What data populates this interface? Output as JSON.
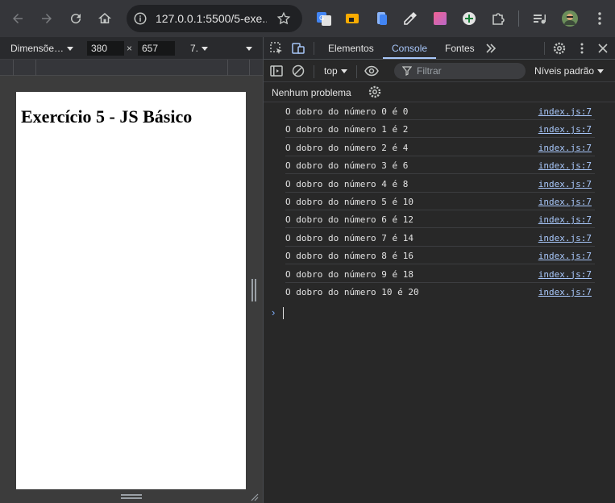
{
  "browser": {
    "url": "127.0.0.1:5500/5-exe...",
    "nav": [
      "back-icon",
      "forward-icon",
      "reload-icon",
      "home-icon"
    ],
    "extensions": [
      "google-translate-icon",
      "extension-icon",
      "extension-icon",
      "eyedropper-icon",
      "extension-icon",
      "plus-icon",
      "puzzle-icon",
      "media-icon",
      "avatar",
      "more-icon"
    ]
  },
  "device_toolbar": {
    "dimensions_label": "Dimensõe…",
    "width": "380",
    "times": "×",
    "height": "657",
    "zoom": "7."
  },
  "page": {
    "heading": "Exercício 5 - JS Básico"
  },
  "devtools": {
    "tabs": [
      {
        "label": "Elementos",
        "active": false
      },
      {
        "label": "Console",
        "active": true
      },
      {
        "label": "Fontes",
        "active": false
      }
    ],
    "context": "top",
    "filter_placeholder": "Filtrar",
    "levels": "Níveis padrão",
    "issues": "Nenhum problema",
    "logs": [
      {
        "msg": "O dobro do número 0 é 0",
        "src": "index.js:7"
      },
      {
        "msg": "O dobro do número 1 é 2",
        "src": "index.js:7"
      },
      {
        "msg": "O dobro do número 2 é 4",
        "src": "index.js:7"
      },
      {
        "msg": "O dobro do número 3 é 6",
        "src": "index.js:7"
      },
      {
        "msg": "O dobro do número 4 é 8",
        "src": "index.js:7"
      },
      {
        "msg": "O dobro do número 5 é 10",
        "src": "index.js:7"
      },
      {
        "msg": "O dobro do número 6 é 12",
        "src": "index.js:7"
      },
      {
        "msg": "O dobro do número 7 é 14",
        "src": "index.js:7"
      },
      {
        "msg": "O dobro do número 8 é 16",
        "src": "index.js:7"
      },
      {
        "msg": "O dobro do número 9 é 18",
        "src": "index.js:7"
      },
      {
        "msg": "O dobro do número 10 é 20",
        "src": "index.js:7"
      }
    ],
    "prompt": "›",
    "accent": "#a8c7fa"
  }
}
